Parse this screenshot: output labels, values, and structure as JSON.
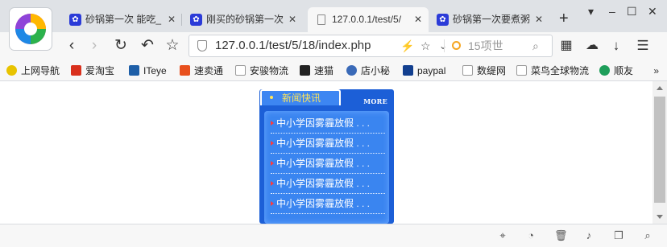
{
  "browser": {
    "tabs": [
      {
        "title": "砂锅第一次 能吃_",
        "icon": "baidu-paw-icon",
        "close": "✕",
        "active": false
      },
      {
        "title": "刚买的砂锅第一次",
        "icon": "baidu-paw-icon",
        "close": "✕",
        "active": false
      },
      {
        "title": "127.0.0.1/test/5/",
        "icon": "page-icon",
        "close": "✕",
        "active": true
      },
      {
        "title": "砂锅第一次要煮粥",
        "icon": "baidu-paw-icon",
        "close": "✕",
        "active": false
      }
    ],
    "new_tab": "+",
    "window_controls": [
      "▾",
      "–",
      "☐",
      "✕"
    ],
    "address": {
      "url": "127.0.0.1/test/5/18/index.php",
      "search_hint": "15项世",
      "search_icon": "magnifier-icon"
    },
    "bookmarks": [
      {
        "label": "上网导航",
        "color": "#e8c300"
      },
      {
        "label": "爱淘宝",
        "color": "#d9301d"
      },
      {
        "label": "ITeye",
        "color": "#1e5fa8"
      },
      {
        "label": "速卖通",
        "color": "#e8501d"
      },
      {
        "label": "安骏物流",
        "color": "#ffffff"
      },
      {
        "label": "速猫",
        "color": "#222222"
      },
      {
        "label": "店小秘",
        "color": "#3a6ab8"
      },
      {
        "label": "paypal",
        "color": "#123f8f"
      },
      {
        "label": "数缇网",
        "color": "#ffffff"
      },
      {
        "label": "菜鸟全球物流",
        "color": "#ffffff"
      },
      {
        "label": "顺友",
        "color": "#1e9e5a"
      }
    ],
    "bookmarks_more": "»"
  },
  "news": {
    "title": "新闻快讯",
    "more": "MORE",
    "items": [
      "中小学因雾霾放假 . . .",
      "中小学因雾霾放假 . . .",
      "中小学因雾霾放假 . . .",
      "中小学因雾霾放假 . . .",
      "中小学因雾霾放假 . . ."
    ]
  },
  "colors": {
    "news_bg": "#1c5fd7",
    "news_panel": "#3a85f0",
    "title_text": "#ffe55a",
    "bullet": "#ff3a3a"
  }
}
